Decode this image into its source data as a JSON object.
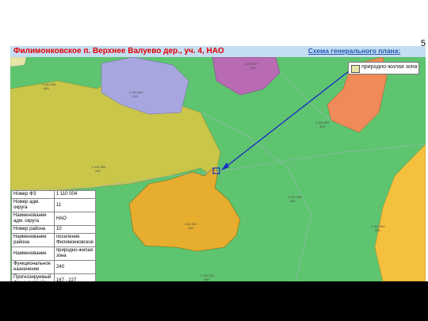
{
  "slide": {
    "page_number": "5",
    "title": "Филимонковское п. Верхнее Валуево дер., уч. 4, НАО",
    "link": "Схема генерального плана: функциональные зоны"
  },
  "legend": {
    "items": [
      {
        "label": "природно-жилая зона",
        "color": "#e8e6a6"
      }
    ]
  },
  "info_table": {
    "rows": [
      {
        "key": "Номер ФЗ",
        "value": "1 110 004"
      },
      {
        "key": "Номер адм. округа",
        "value": "11"
      },
      {
        "key": "Наименование адм. округа",
        "value": "НАО"
      },
      {
        "key": "Номер района",
        "value": "10"
      },
      {
        "key": "Наименование района",
        "value": "поселение Филимонковское"
      },
      {
        "key": "Наименование",
        "value": "природно-жилая зона"
      },
      {
        "key": "Функциональное назначение",
        "value": "240"
      },
      {
        "key": "Прогнозируемый фонд застройки",
        "value": "167 - 227"
      }
    ]
  },
  "map_labels": [
    "1 110 005\n400",
    "1 110 003\n200",
    "1 110 007\n310",
    "1 110 001\n400",
    "1 110 004\n240",
    "1 110 006\n400",
    "1 110 022\n140",
    "1 110 004\n400",
    "1 110 021\n400"
  ],
  "colors": {
    "header_bar": "#c5ddf1",
    "title_red": "#e00000",
    "link_blue": "#1f56b5",
    "zone_green": "#5ec46f",
    "zone_olive": "#c9c64a",
    "zone_lavender": "#a8a6df",
    "zone_purple": "#b86bb3",
    "zone_orange": "#f08a58",
    "zone_yellow": "#f5c03d",
    "zone_gold": "#e6ad2e",
    "arrow": "#1a2fc4"
  }
}
